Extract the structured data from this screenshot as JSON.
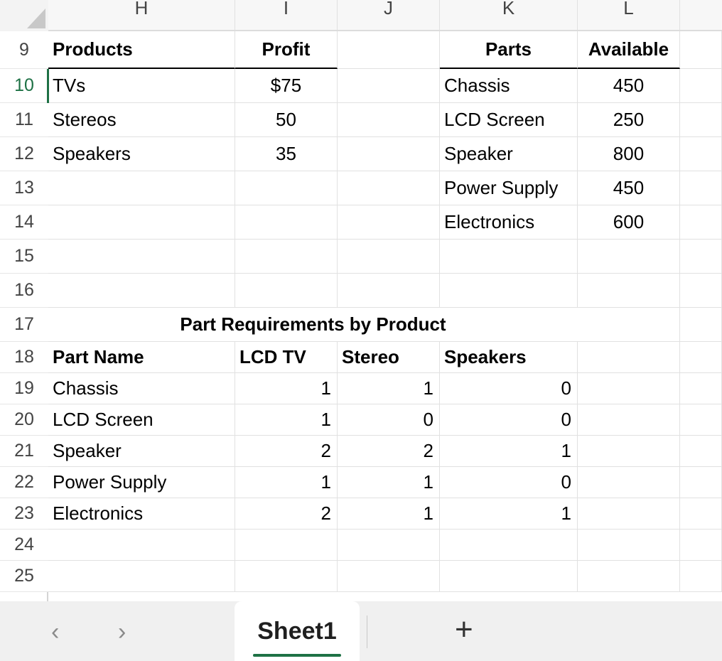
{
  "columns": [
    "H",
    "I",
    "J",
    "K",
    "L"
  ],
  "rows": [
    "9",
    "10",
    "11",
    "12",
    "13",
    "14",
    "15",
    "16",
    "17",
    "18",
    "19",
    "20",
    "21",
    "22",
    "23",
    "24",
    "25"
  ],
  "products_table": {
    "header_products": "Products",
    "header_profit": "Profit",
    "items": [
      {
        "name": "TVs",
        "profit": "$75"
      },
      {
        "name": "Stereos",
        "profit": "50"
      },
      {
        "name": "Speakers",
        "profit": "35"
      }
    ]
  },
  "parts_table": {
    "header_parts": "Parts",
    "header_available": "Available",
    "items": [
      {
        "name": "Chassis",
        "available": "450"
      },
      {
        "name": "LCD Screen",
        "available": "250"
      },
      {
        "name": "Speaker",
        "available": "800"
      },
      {
        "name": "Power Supply",
        "available": "450"
      },
      {
        "name": "Electronics",
        "available": "600"
      }
    ]
  },
  "requirements_table": {
    "title": "Part Requirements by Product",
    "header_part_name": "Part Name",
    "header_lcd_tv": "LCD TV",
    "header_stereo": "Stereo",
    "header_speakers": "Speakers",
    "rows": [
      {
        "part": "Chassis",
        "lcd_tv": "1",
        "stereo": "1",
        "speakers": "0"
      },
      {
        "part": "LCD Screen",
        "lcd_tv": "1",
        "stereo": "0",
        "speakers": "0"
      },
      {
        "part": "Speaker",
        "lcd_tv": "2",
        "stereo": "2",
        "speakers": "1"
      },
      {
        "part": "Power Supply",
        "lcd_tv": "1",
        "stereo": "1",
        "speakers": "0"
      },
      {
        "part": "Electronics",
        "lcd_tv": "2",
        "stereo": "1",
        "speakers": "1"
      }
    ]
  },
  "sheet_tabs": {
    "active_tab": "Sheet1",
    "prev_icon": "chevron-left-icon",
    "next_icon": "chevron-right-icon",
    "add_icon": "plus-icon",
    "prev_glyph": "‹",
    "next_glyph": "›",
    "add_glyph": "+"
  },
  "colors": {
    "accent": "#1e7145"
  }
}
